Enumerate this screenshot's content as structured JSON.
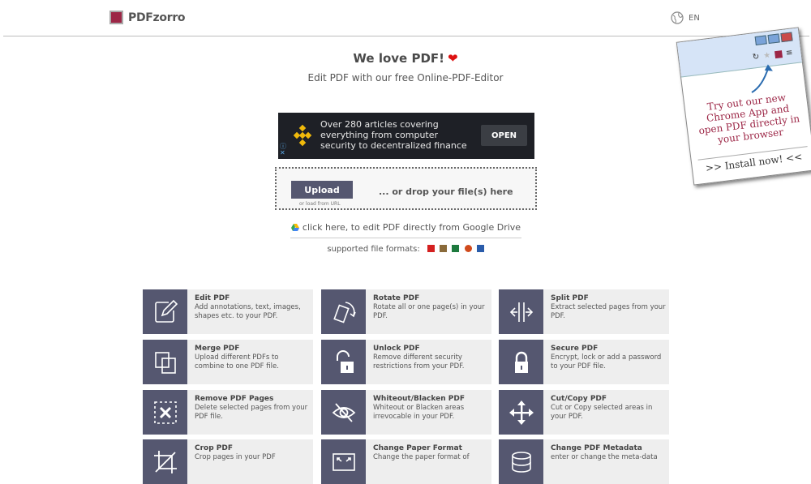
{
  "header": {
    "brand": "PDFzorro",
    "language": "EN"
  },
  "hero": {
    "title": "We love PDF!",
    "heart": "❤",
    "subtitle": "Edit PDF with our free Online-PDF-Editor"
  },
  "ad": {
    "text": "Over 280 articles covering everything from computer security to decentralized finance",
    "button": "OPEN"
  },
  "upload": {
    "button": "Upload",
    "load_url": "or load from URL",
    "drop_text": "... or drop your file(s) here"
  },
  "gdrive": {
    "text": "click here, to edit PDF directly from Google Drive"
  },
  "formats": {
    "label": "supported file formats:",
    "icons": [
      "pdf-icon",
      "image-icon",
      "excel-icon",
      "powerpoint-icon",
      "word-icon"
    ],
    "colors": [
      "#d42020",
      "#8a6a3a",
      "#1e7a3e",
      "#d04a1c",
      "#2a5caa"
    ]
  },
  "promo": {
    "text": "Try out our new Chrome App and open PDF directly in your browser",
    "install": ">> Install now! <<"
  },
  "tools": [
    {
      "name": "Edit PDF",
      "desc": "Add annotations, text, images, shapes etc. to your PDF.",
      "icon": "edit-icon"
    },
    {
      "name": "Rotate PDF",
      "desc": "Rotate all or one page(s) in your PDF.",
      "icon": "rotate-icon"
    },
    {
      "name": "Split PDF",
      "desc": "Extract selected pages from your PDF.",
      "icon": "split-icon"
    },
    {
      "name": "Merge PDF",
      "desc": "Upload different PDFs to combine to one PDF file.",
      "icon": "merge-icon"
    },
    {
      "name": "Unlock PDF",
      "desc": "Remove different security restrictions from your PDF.",
      "icon": "unlock-icon"
    },
    {
      "name": "Secure PDF",
      "desc": "Encrypt, lock or add a password to your PDF file.",
      "icon": "lock-icon"
    },
    {
      "name": "Remove PDF Pages",
      "desc": "Delete selected pages from your PDF file.",
      "icon": "remove-pages-icon"
    },
    {
      "name": "Whiteout/Blacken PDF",
      "desc": "Whiteout or Blacken areas irrevocable in your PDF.",
      "icon": "eye-slash-icon"
    },
    {
      "name": "Cut/Copy PDF",
      "desc": "Cut or Copy selected areas in your PDF.",
      "icon": "move-icon"
    },
    {
      "name": "Crop PDF",
      "desc": "Crop pages in your PDF",
      "icon": "crop-icon"
    },
    {
      "name": "Change Paper Format",
      "desc": "Change the paper format of",
      "icon": "resize-icon"
    },
    {
      "name": "Change PDF Metadata",
      "desc": "enter or change the meta-data",
      "icon": "database-icon"
    }
  ]
}
